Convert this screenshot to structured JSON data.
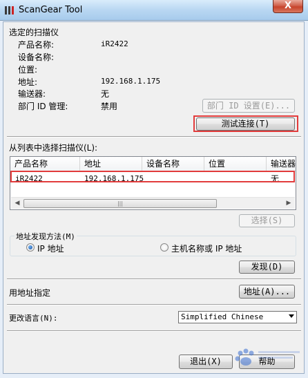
{
  "window": {
    "title": "ScanGear Tool",
    "close_label": "X"
  },
  "selected_scanner": {
    "section_label": "选定的扫描仪",
    "product_name_label": "产品名称:",
    "product_name_value": "iR2422",
    "device_name_label": "设备名称:",
    "location_label": "位置:",
    "address_label": "地址:",
    "address_value": "192.168.1.175",
    "feeder_label": "输送器:",
    "feeder_value": "无",
    "dept_id_label": "部门 ID 管理:",
    "dept_id_value": "禁用",
    "dept_id_button": "部门 ID 设置(E)...",
    "test_connection_button": "测试连接(T)"
  },
  "scanner_list": {
    "label": "从列表中选择扫描仪(L):",
    "columns": [
      "产品名称",
      "地址",
      "设备名称",
      "位置",
      "输送器"
    ],
    "rows": [
      {
        "product": "iR2422",
        "address": "192.168.1.175",
        "device": "",
        "location": "",
        "feeder": "无"
      }
    ],
    "select_button": "选择(S)"
  },
  "address_discovery": {
    "label": "地址发现方法(M)",
    "option_ip": "IP 地址",
    "option_host": "主机名称或 IP 地址",
    "selected": "IP 地址",
    "discover_button": "发现(D)"
  },
  "specify_address": {
    "label": "用地址指定",
    "button": "地址(A)..."
  },
  "language": {
    "label": "更改语言(N):",
    "value": "Simplified Chinese"
  },
  "footer": {
    "exit_button": "退出(X)",
    "help_button": "帮助"
  },
  "colors": {
    "highlight": "#e23b3b",
    "title_bar": "#b9d7f2",
    "client_bg": "#f0f0f0"
  }
}
